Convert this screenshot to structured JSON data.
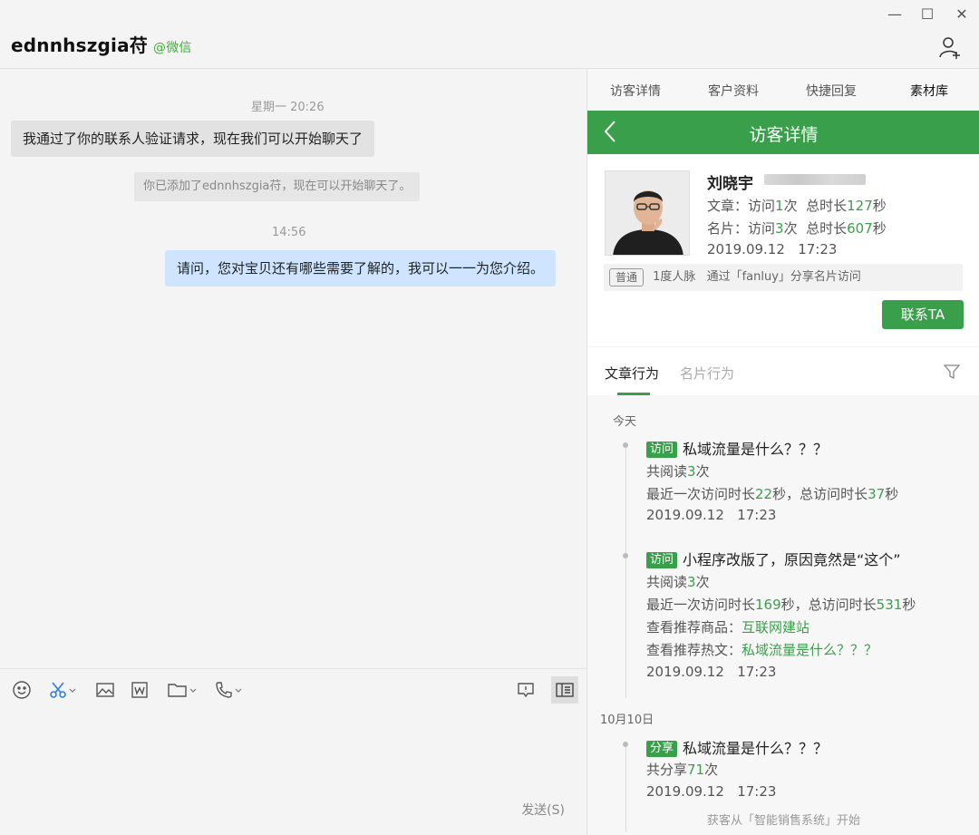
{
  "titlebar": {
    "contact_name": "ednnhszgia苻",
    "wechat_tag": "@微信",
    "minimize": "—",
    "maximize": "☐",
    "close": "✕"
  },
  "chat": {
    "timestamp_1": "星期一 20:26",
    "incoming_message": "我通过了你的联系人验证请求，现在我们可以开始聊天了",
    "system_message": "你已添加了ednnhszgia苻，现在可以开始聊天了。",
    "timestamp_2": "14:56",
    "outgoing_message": "请问，您对宝贝还有哪些需要了解的，我可以一一为您介绍。",
    "send_label": "发送(S)"
  },
  "toolbar": {
    "icons": [
      "emoji-icon",
      "scissors-icon",
      "image-icon",
      "word-doc-icon",
      "folder-icon",
      "phone-icon",
      "screen-comment-icon",
      "sidebar-toggle-icon"
    ]
  },
  "panel": {
    "tabs": [
      "访客详情",
      "客户资料",
      "快捷回复",
      "素材库"
    ],
    "active_tab": "素材库",
    "header_title": "访客详情",
    "visitor": {
      "name": "刘晓宇",
      "article_stat_prefix": "文章：访问",
      "article_visits": "1",
      "article_mid": "次  总时长",
      "article_duration": "127",
      "article_suffix": "秒",
      "card_stat_prefix": "名片：访问",
      "card_visits": "3",
      "card_mid": "次  总时长",
      "card_duration": "607",
      "card_suffix": "秒",
      "time": "2019.09.12   17:23",
      "level_tag": "普通",
      "degree": "1度人脉",
      "source": "通过「fanluy」分享名片访问",
      "contact_button": "联系TA"
    },
    "sub_tabs": [
      "文章行为",
      "名片行为"
    ],
    "timeline": {
      "day_1": "今天",
      "day_2": "10月10日",
      "events": [
        {
          "tag": "访问",
          "title": "私域流量是什么？？？",
          "read_prefix": "共阅读",
          "read_count": "3",
          "read_suffix": "次",
          "last_prefix": "最近一次访问时长",
          "last_val": "22",
          "last_mid": "秒，总访问时长",
          "total_val": "37",
          "total_suffix": "秒",
          "time": "2019.09.12   17:23"
        },
        {
          "tag": "访问",
          "title": "小程序改版了，原因竟然是“这个”",
          "read_prefix": "共阅读",
          "read_count": "3",
          "read_suffix": "次",
          "last_prefix": "最近一次访问时长",
          "last_val": "169",
          "last_mid": "秒，总访问时长",
          "total_val": "531",
          "total_suffix": "秒",
          "product_prefix": "查看推荐商品：",
          "product": "互联网建站",
          "hot_prefix": "查看推荐热文：",
          "hot": "私域流量是什么？？？",
          "time": "2019.09.12   17:23"
        },
        {
          "tag": "分享",
          "title": "私域流量是什么？？？",
          "share_prefix": "共分享",
          "share_count": "71",
          "share_suffix": "次",
          "time": "2019.09.12   17:23"
        }
      ]
    },
    "footer": "获客从「智能销售系统」开始"
  },
  "colors": {
    "brand_green": "#3a9f4a",
    "outgoing_bubble": "#cfe5ff",
    "incoming_bubble": "#e2e2e2"
  }
}
